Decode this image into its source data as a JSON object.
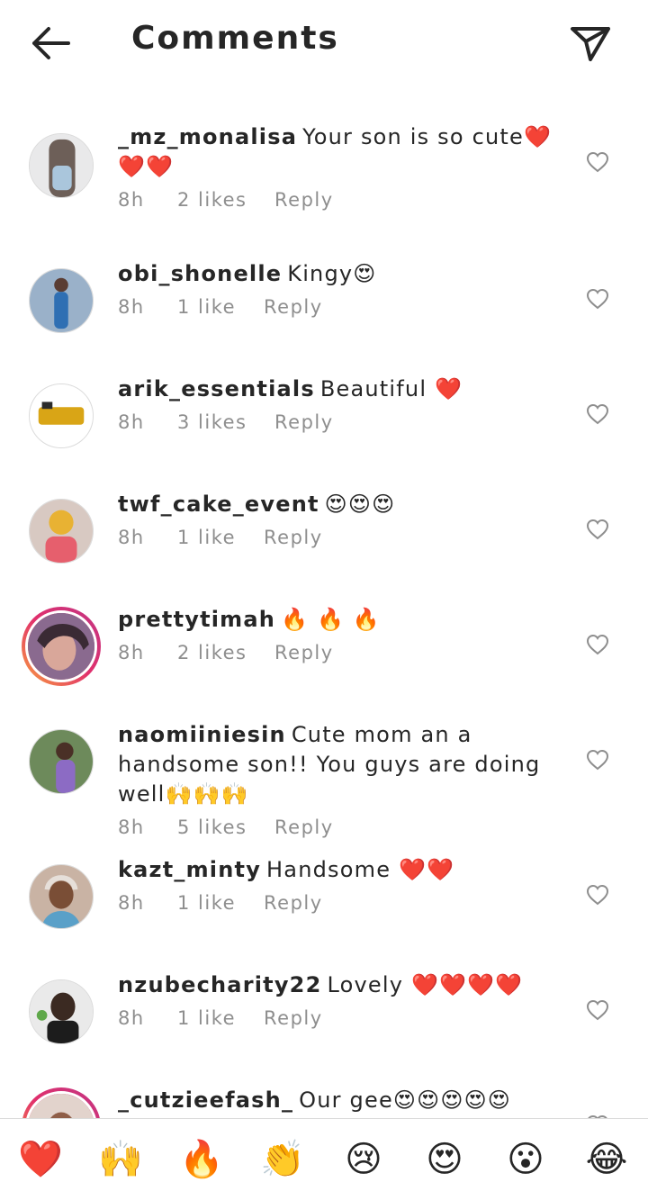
{
  "header": {
    "title": "Comments"
  },
  "icons": {
    "back": "arrow-left-icon",
    "send": "paper-plane-icon",
    "like": "heart-outline-icon"
  },
  "comments": [
    {
      "username": "_mz_monalisa",
      "text": "Your son is so cute❤️❤️❤️",
      "time": "8h",
      "likes": "2 likes",
      "reply": "Reply"
    },
    {
      "username": "obi_shonelle",
      "text": "Kingy😍",
      "time": "8h",
      "likes": "1 like",
      "reply": "Reply"
    },
    {
      "username": "arik_essentials",
      "text": "Beautiful ❤️",
      "time": "8h",
      "likes": "3 likes",
      "reply": "Reply"
    },
    {
      "username": "twf_cake_event",
      "text": "😍😍😍",
      "time": "8h",
      "likes": "1 like",
      "reply": "Reply"
    },
    {
      "username": "prettytimah",
      "text": "🔥 🔥 🔥",
      "time": "8h",
      "likes": "2 likes",
      "reply": "Reply"
    },
    {
      "username": "naomiiniesin",
      "text": "Cute mom an a handsome son!! You guys are doing well🙌🙌🙌",
      "time": "8h",
      "likes": "5 likes",
      "reply": "Reply"
    },
    {
      "username": "kazt_minty",
      "text": "Handsome ❤️❤️",
      "time": "8h",
      "likes": "1 like",
      "reply": "Reply"
    },
    {
      "username": "nzubecharity22",
      "text": "Lovely ❤️❤️❤️❤️",
      "time": "8h",
      "likes": "1 like",
      "reply": "Reply"
    },
    {
      "username": "_cutzieefash_",
      "text": "Our gee😍😍😍😍😍",
      "time": "",
      "likes": "",
      "reply": ""
    }
  ],
  "emoji_bar": [
    "❤️",
    "🙌",
    "🔥",
    "👏",
    "😢",
    "😍",
    "😮",
    "😂"
  ],
  "colors": {
    "meta_text": "#8e8e8e",
    "story_ring_start": "#f9a13e",
    "story_ring_end": "#c13584"
  }
}
